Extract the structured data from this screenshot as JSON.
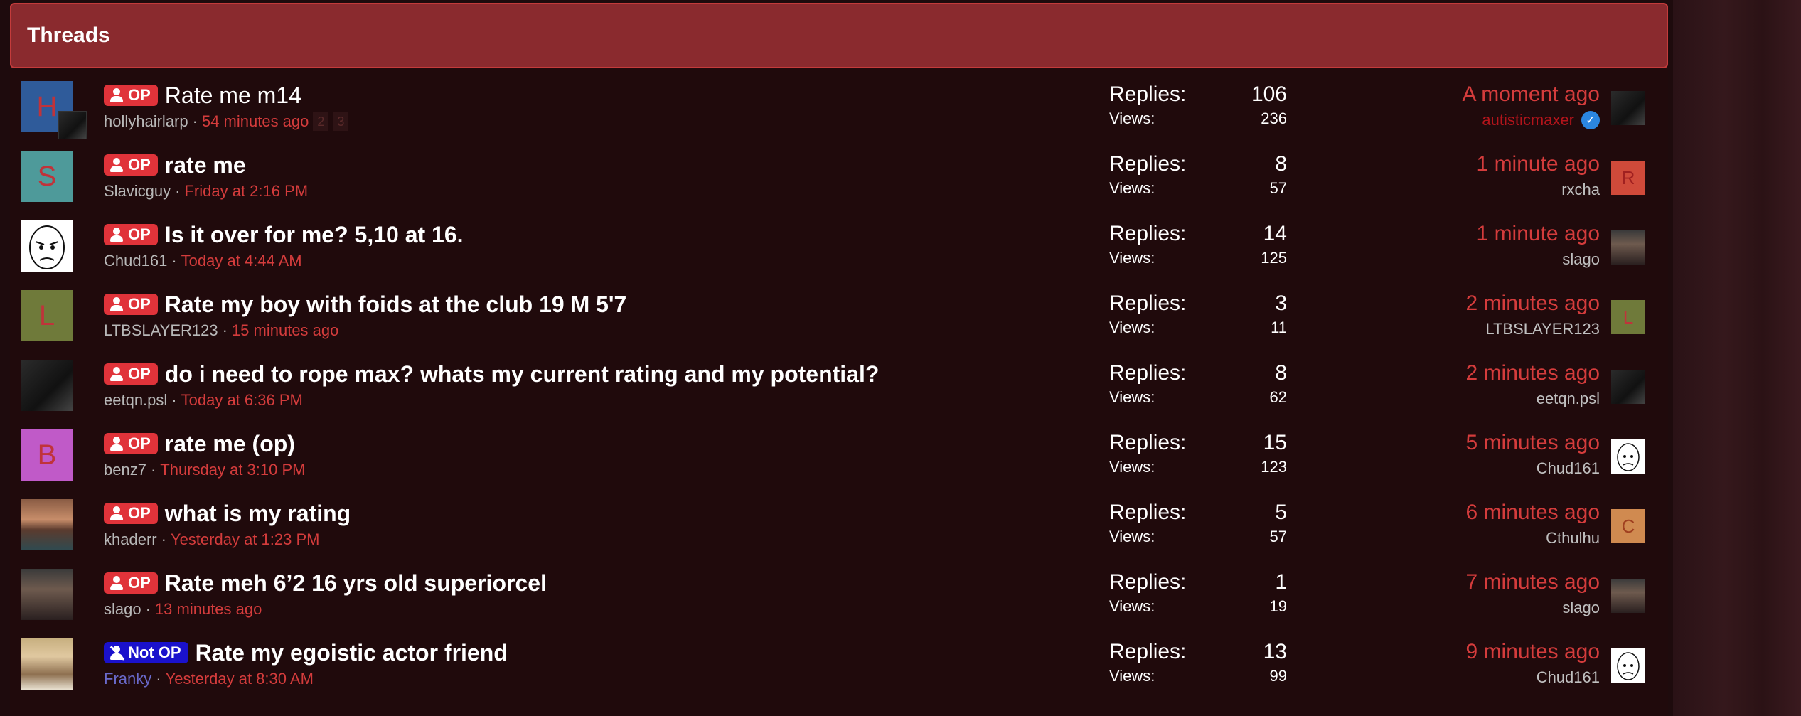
{
  "section_title": "Threads",
  "labels": {
    "replies": "Replies:",
    "views": "Views:"
  },
  "colors": {
    "op_badge": "#e0333a",
    "notop_badge": "#1a11cc",
    "header_bg": "#8a2a2e",
    "accent_red": "#d43c3c"
  },
  "threads": [
    {
      "avatar_letter": "H",
      "avatar_color": "#2f5b9a",
      "badge": "OP",
      "title": "Rate me m14",
      "author": "hollyhairlarp",
      "date": "54 minutes ago",
      "pages": [
        "2",
        "3"
      ],
      "replies": "106",
      "views": "236",
      "last_time": "A moment ago",
      "last_user": "autisticmaxer",
      "last_avatar": "dark"
    },
    {
      "avatar_letter": "S",
      "avatar_color": "#4e9a9a",
      "badge": "OP",
      "title": "rate me",
      "author": "Slavicguy",
      "date": "Friday at 2:16 PM",
      "replies": "8",
      "views": "57",
      "last_time": "1 minute ago",
      "last_user": "rxcha",
      "last_avatar_letter": "R",
      "last_avatar_color": "#d04a3a"
    },
    {
      "avatar_face": true,
      "badge": "OP",
      "title": "Is it over for me? 5,10 at 16.",
      "author": "Chud161",
      "date": "Today at 4:44 AM",
      "replies": "14",
      "views": "125",
      "last_time": "1 minute ago",
      "last_user": "slago",
      "last_avatar": "man"
    },
    {
      "avatar_letter": "L",
      "avatar_color": "#6f7a3a",
      "badge": "OP",
      "title": "Rate my boy with foids at the club 19 M 5'7",
      "author": "LTBSLAYER123",
      "date": "15 minutes ago",
      "replies": "3",
      "views": "11",
      "last_time": "2 minutes ago",
      "last_user": "LTBSLAYER123",
      "last_avatar_letter": "L",
      "last_avatar_color": "#6f7a3a"
    },
    {
      "avatar_photo": "dark",
      "badge": "OP",
      "title": "do i need to rope max? whats my current rating and my potential?",
      "author": "eetqn.psl",
      "date": "Today at 6:36 PM",
      "replies": "8",
      "views": "62",
      "last_time": "2 minutes ago",
      "last_user": "eetqn.psl",
      "last_avatar": "dark"
    },
    {
      "avatar_letter": "B",
      "avatar_color": "#c05ac8",
      "badge": "OP",
      "title": "rate me (op)",
      "author": "benz7",
      "date": "Thursday at 3:10 PM",
      "replies": "15",
      "views": "123",
      "last_time": "5 minutes ago",
      "last_user": "Chud161",
      "last_avatar": "face"
    },
    {
      "avatar_photo": "eyes",
      "badge": "OP",
      "title": "what is my rating",
      "author": "khaderr",
      "date": "Yesterday at 1:23 PM",
      "replies": "5",
      "views": "57",
      "last_time": "6 minutes ago",
      "last_user": "Cthulhu",
      "last_avatar_letter": "C",
      "last_avatar_color": "#d08a50"
    },
    {
      "avatar_photo": "man",
      "badge": "OP",
      "title": "Rate meh 6’2 16 yrs old superiorcel",
      "author": "slago",
      "date": "13 minutes ago",
      "replies": "1",
      "views": "19",
      "last_time": "7 minutes ago",
      "last_user": "slago",
      "last_avatar": "man"
    },
    {
      "avatar_photo": "blond",
      "badge": "Not OP",
      "title": "Rate my egoistic actor friend",
      "author": "Franky",
      "date": "Yesterday at 8:30 AM",
      "replies": "13",
      "views": "99",
      "last_time": "9 minutes ago",
      "last_user": "Chud161",
      "last_avatar": "face"
    }
  ]
}
